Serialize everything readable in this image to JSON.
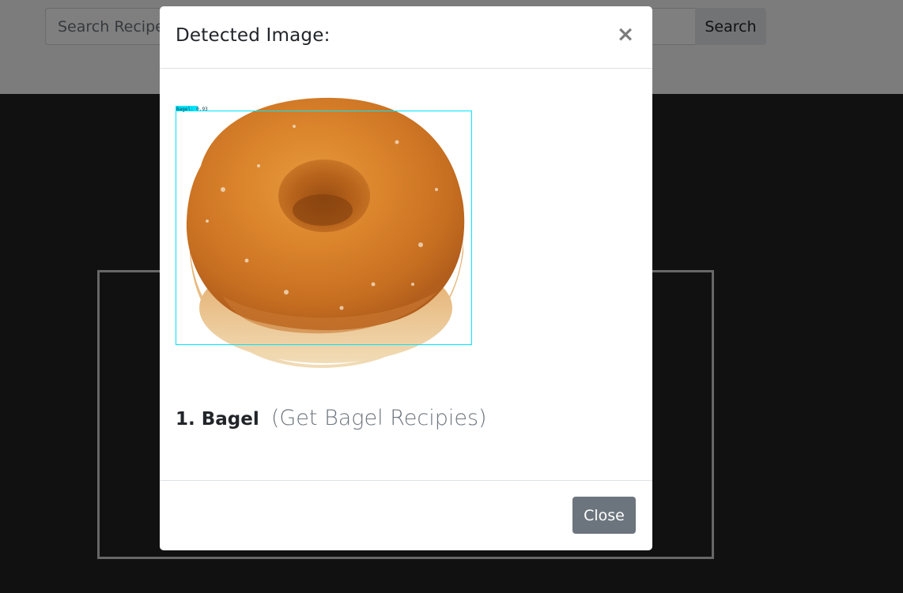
{
  "search": {
    "placeholder": "Search Recipe",
    "button_label": "Search"
  },
  "modal": {
    "title": "Detected Image:",
    "close_x": "×",
    "detection": {
      "box_label": "Bagel: 0.93",
      "box_color": "#00e5ff"
    },
    "result": {
      "label": "1. Bagel",
      "link_text": "(Get Bagel Recipies)"
    },
    "footer": {
      "close_label": "Close"
    }
  }
}
